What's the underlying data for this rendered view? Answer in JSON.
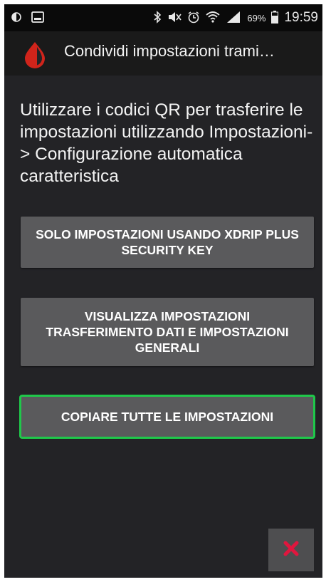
{
  "status_bar": {
    "battery_pct": "69%",
    "time": "19:59",
    "icons": [
      "alarm-icon",
      "image-icon",
      "bluetooth-icon",
      "mute-icon",
      "clock-alarm-icon",
      "wifi-icon",
      "signal-icon",
      "battery-icon"
    ]
  },
  "app_bar": {
    "title": "Condividi impostazioni trami…",
    "icon": "droplet-icon",
    "accent": "#d0241b"
  },
  "intro_text": "Utilizzare i codici QR per trasferire le impostazioni utilizzando Impostazioni-> Configurazione automatica caratteristica",
  "buttons": [
    {
      "label": "SOLO IMPOSTAZIONI USANDO XDRIP PLUS SECURITY KEY"
    },
    {
      "label": "VISUALIZZA IMPOSTAZIONI TRASFERIMENTO DATI E IMPOSTAZIONI GENERALI"
    },
    {
      "label": "COPIARE TUTTE LE IMPOSTAZIONI",
      "highlight_color": "#1fc84a"
    }
  ],
  "close_button": {
    "icon": "close-icon",
    "color": "#e0163e"
  }
}
